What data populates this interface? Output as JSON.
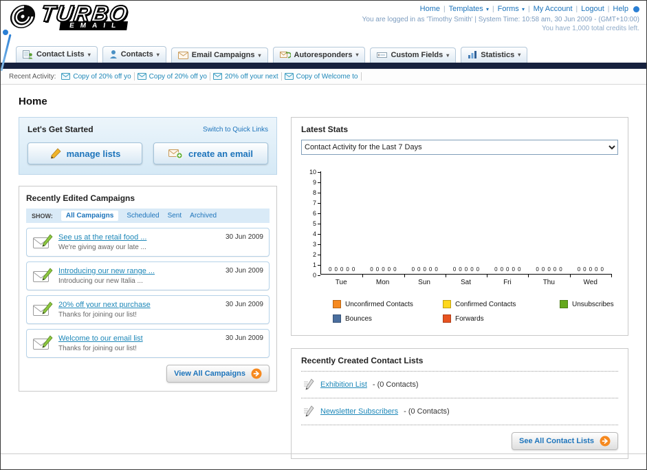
{
  "header": {
    "logo_primary": "TURBO",
    "logo_secondary": "EMAIL",
    "nav": [
      {
        "label": "Home",
        "dropdown": false
      },
      {
        "label": "Templates",
        "dropdown": true
      },
      {
        "label": "Forms",
        "dropdown": true
      },
      {
        "label": "My Account",
        "dropdown": false
      },
      {
        "label": "Logout",
        "dropdown": false
      },
      {
        "label": "Help",
        "dropdown": false
      }
    ],
    "login_info": "You are logged in as 'Timothy Smith' | System Time: 10:58 am, 30 Jun 2009 - (GMT+10:00)",
    "credits_info": "You have 1,000 total credits left."
  },
  "tabs": [
    {
      "label": "Contact Lists",
      "icon": "contact-lists-icon"
    },
    {
      "label": "Contacts",
      "icon": "contacts-icon"
    },
    {
      "label": "Email Campaigns",
      "icon": "email-campaigns-icon"
    },
    {
      "label": "Autoresponders",
      "icon": "autoresponders-icon"
    },
    {
      "label": "Custom Fields",
      "icon": "custom-fields-icon"
    },
    {
      "label": "Statistics",
      "icon": "statistics-icon"
    }
  ],
  "recent_activity": {
    "label": "Recent Activity:",
    "items": [
      "Copy of 20% off yo",
      "Copy of 20% off yo",
      "20% off your next",
      "Copy of Welcome to"
    ]
  },
  "page_title": "Home",
  "get_started": {
    "title": "Let's Get Started",
    "switch_link": "Switch to Quick Links",
    "manage_lists_label": "manage lists",
    "create_email_label": "create an email"
  },
  "campaigns": {
    "title": "Recently Edited Campaigns",
    "show_label": "SHOW:",
    "filters": [
      "All Campaigns",
      "Scheduled",
      "Sent",
      "Archived"
    ],
    "selected_filter": "All Campaigns",
    "items": [
      {
        "title": "See us at the retail food ...",
        "subtitle": "We're giving away our late ...",
        "date": "30 Jun 2009"
      },
      {
        "title": "Introducing our new range ...",
        "subtitle": "Introducing our new Italia ...",
        "date": "30 Jun 2009"
      },
      {
        "title": "20% off your next purchase",
        "subtitle": "Thanks for joining our list!",
        "date": "30 Jun 2009"
      },
      {
        "title": "Welcome to our email list",
        "subtitle": "Thanks for joining our list!",
        "date": "30 Jun 2009"
      }
    ],
    "view_all_label": "View All Campaigns"
  },
  "stats": {
    "title": "Latest Stats",
    "range_selected": "Contact Activity for the Last 7 Days",
    "chart_data": {
      "type": "bar",
      "title": "Contact Activity for the Last 7 Days",
      "categories": [
        "Tue",
        "Mon",
        "Sun",
        "Sat",
        "Fri",
        "Thu",
        "Wed"
      ],
      "series": [
        {
          "name": "Unconfirmed Contacts",
          "color": "#f6891f",
          "values": [
            0,
            0,
            0,
            0,
            0,
            0,
            0
          ]
        },
        {
          "name": "Confirmed Contacts",
          "color": "#ffd71c",
          "values": [
            0,
            0,
            0,
            0,
            0,
            0,
            0
          ]
        },
        {
          "name": "Unsubscribes",
          "color": "#64a81d",
          "values": [
            0,
            0,
            0,
            0,
            0,
            0,
            0
          ]
        },
        {
          "name": "Bounces",
          "color": "#4a6e9e",
          "values": [
            0,
            0,
            0,
            0,
            0,
            0,
            0
          ]
        },
        {
          "name": "Forwards",
          "color": "#e85321",
          "values": [
            0,
            0,
            0,
            0,
            0,
            0,
            0
          ]
        }
      ],
      "ylim": [
        0,
        10
      ],
      "ytick_step": 1,
      "grid": false,
      "legend_position": "bottom",
      "value_labels": true
    }
  },
  "contact_lists": {
    "title": "Recently Created Contact Lists",
    "items": [
      {
        "name": "Exhibition List",
        "detail": "- (0 Contacts)"
      },
      {
        "name": "Newsletter Subscribers",
        "detail": "- (0 Contacts)"
      }
    ],
    "see_all_label": "See All Contact Lists"
  },
  "colors": {
    "link_blue": "#1d74bb",
    "teal_link": "#1d87b8",
    "dark_bar": "#16213e",
    "accent_orange": "#f6891f"
  }
}
